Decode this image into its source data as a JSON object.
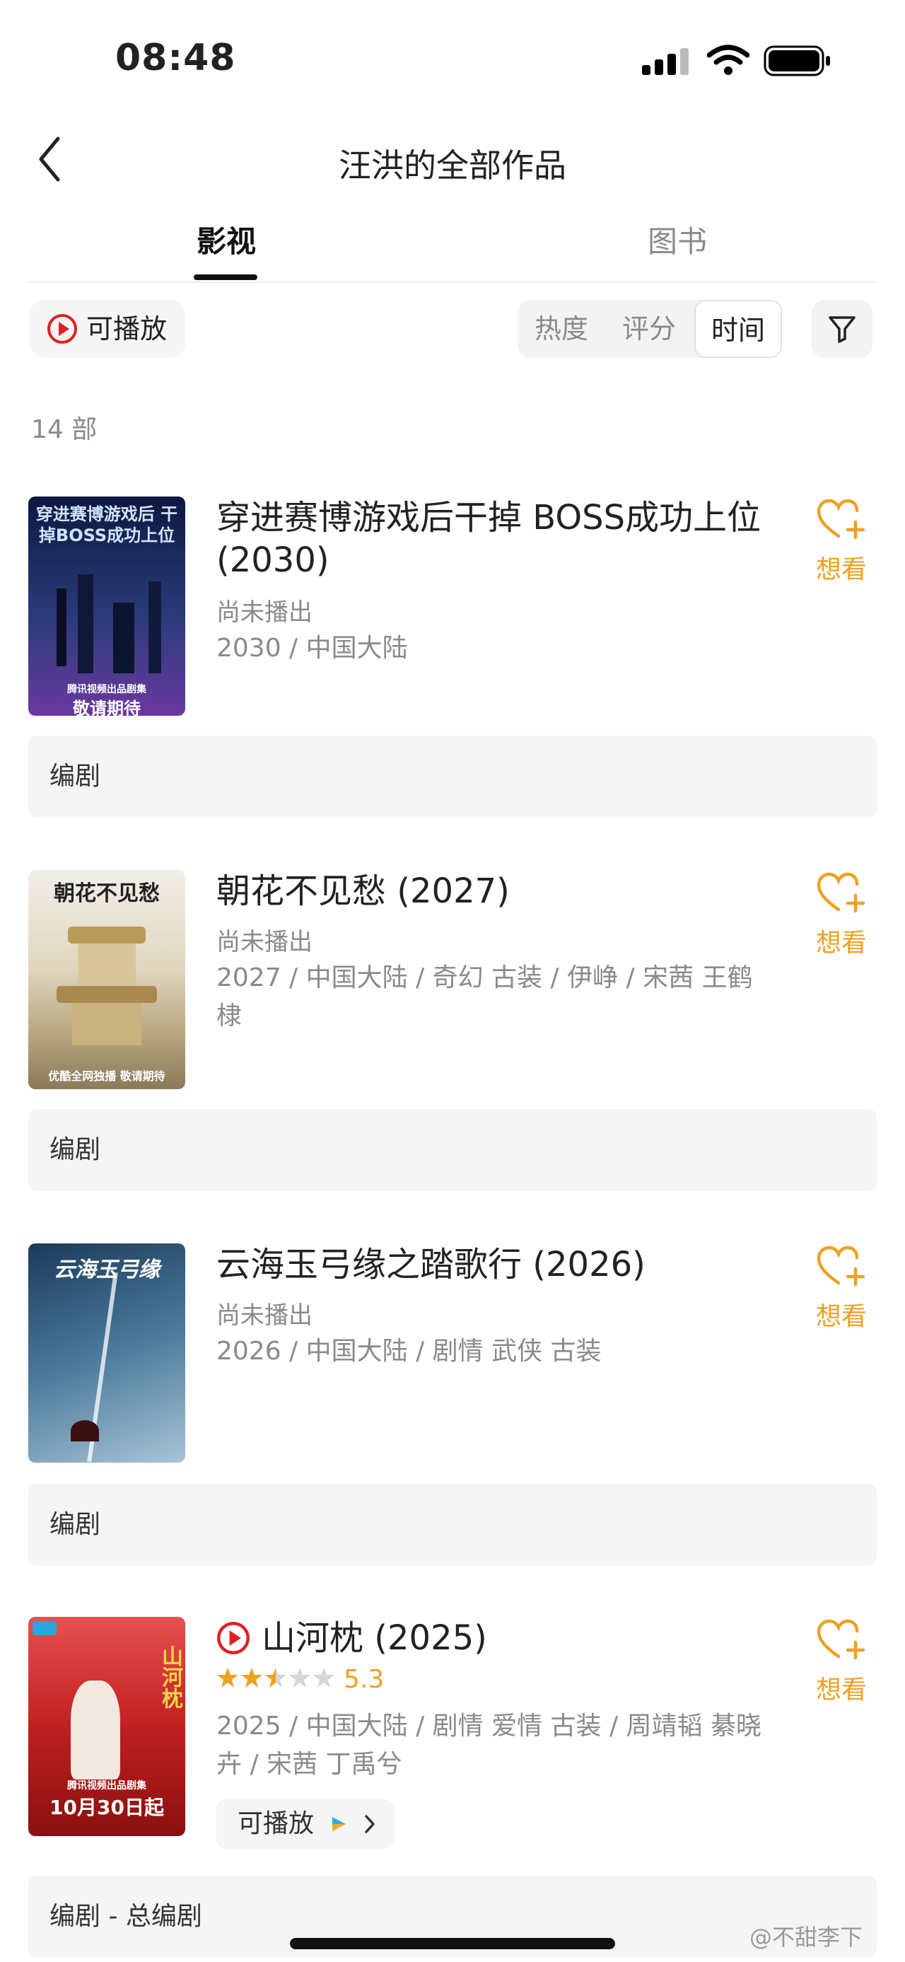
{
  "status_bar": {
    "time": "08:48"
  },
  "nav": {
    "title": "汪洪的全部作品"
  },
  "tabs": [
    {
      "label": "影视",
      "active": true
    },
    {
      "label": "图书",
      "active": false
    }
  ],
  "filters": {
    "playable_label": "可播放",
    "sort_options": [
      "热度",
      "评分",
      "时间"
    ],
    "active_sort": "时间"
  },
  "count": "14 部",
  "items": [
    {
      "title": "穿进赛博游戏后干掉 BOSS成功上位 (2030)",
      "status": "尚未播出",
      "meta": "2030 / 中国大陆",
      "role": "编剧",
      "want_label": "想看",
      "poster": {
        "top_text": "穿进赛博游戏后 干掉BOSS成功上位",
        "small_caption": "腾讯视频出品剧集",
        "bottom_text": "敬请期待",
        "colors": [
          "#0d1840",
          "#2a3b7a",
          "#6a3aa0"
        ]
      }
    },
    {
      "title": "朝花不见愁 (2027)",
      "status": "尚未播出",
      "meta": "2027 / 中国大陆 / 奇幻 古装 / 伊峥 / 宋茜 王鹤棣",
      "role": "编剧",
      "want_label": "想看",
      "poster": {
        "top_text": "朝花不见愁",
        "small_caption": "",
        "bottom_text": "优酷全网独播 敬请期待",
        "colors": [
          "#e9e6df",
          "#cbb98f",
          "#8a7a5a"
        ]
      }
    },
    {
      "title": "云海玉弓缘之踏歌行 (2026)",
      "status": "尚未播出",
      "meta": "2026 / 中国大陆 / 剧情 武侠 古装",
      "role": "编剧",
      "want_label": "想看",
      "poster": {
        "top_text": "云海玉弓缘",
        "small_caption": "",
        "bottom_text": "",
        "colors": [
          "#1c3a5a",
          "#4a7a9a",
          "#a8c4d8"
        ]
      }
    },
    {
      "title": "山河枕 (2025)",
      "rating": 5.3,
      "rating_text": "5.3",
      "meta": "2025 / 中国大陆 / 剧情 爱情 古装 / 周靖韬 綦晓卉 / 宋茜 丁禹兮",
      "play_chip": "可播放",
      "role": "编剧 - 总编剧",
      "want_label": "想看",
      "poster": {
        "top_text": "山河枕",
        "small_caption": "腾讯视频出品剧集",
        "bottom_text": "10月30日起",
        "colors": [
          "#c02020",
          "#e85050",
          "#f3d0c0"
        ]
      }
    }
  ],
  "watermark": "@不甜李下",
  "colors": {
    "accent_orange": "#f0a020",
    "play_red": "#e02020",
    "gray_text": "#8a8a8a"
  }
}
